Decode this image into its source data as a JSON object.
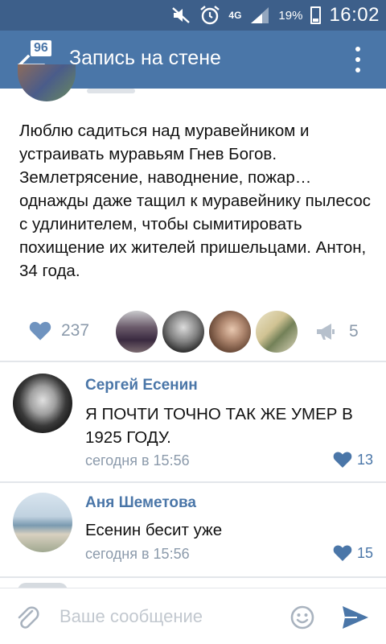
{
  "status_bar": {
    "network": "4G",
    "battery_percent": "19%",
    "time": "16:02",
    "icons": [
      "mute-icon",
      "alarm-icon",
      "signal-icon",
      "battery-icon"
    ]
  },
  "app_bar": {
    "title": "Запись на стене",
    "back_badge": "96",
    "icons": [
      "back-arrow-icon",
      "more-vertical-icon"
    ]
  },
  "post": {
    "text": "Люблю садиться над муравейником и устраивать муравьям Гнев Богов. Землетрясение, наводнение, пожар… однажды даже тащил к муравейнику пылесос с удлинителем, чтобы сымитировать похищение их жителей пришельцами. Антон, 34 года.",
    "likes": "237",
    "reposts": "5"
  },
  "comments": [
    {
      "author": "Сергей Есенин",
      "text": "Я ПОЧТИ ТОЧНО ТАК ЖЕ УМЕР В 1925 ГОДУ.",
      "time": "сегодня в 15:56",
      "likes": "13"
    },
    {
      "author": "Аня Шеметова",
      "text": "Есенин бесит уже",
      "time": "сегодня в 15:56",
      "likes": "15"
    }
  ],
  "composer": {
    "placeholder": "Ваше сообщение"
  },
  "colors": {
    "status_bar": "#3d5f8a",
    "app_bar": "#4a76a8",
    "accent": "#4a76a8",
    "muted": "#8b9aab"
  }
}
